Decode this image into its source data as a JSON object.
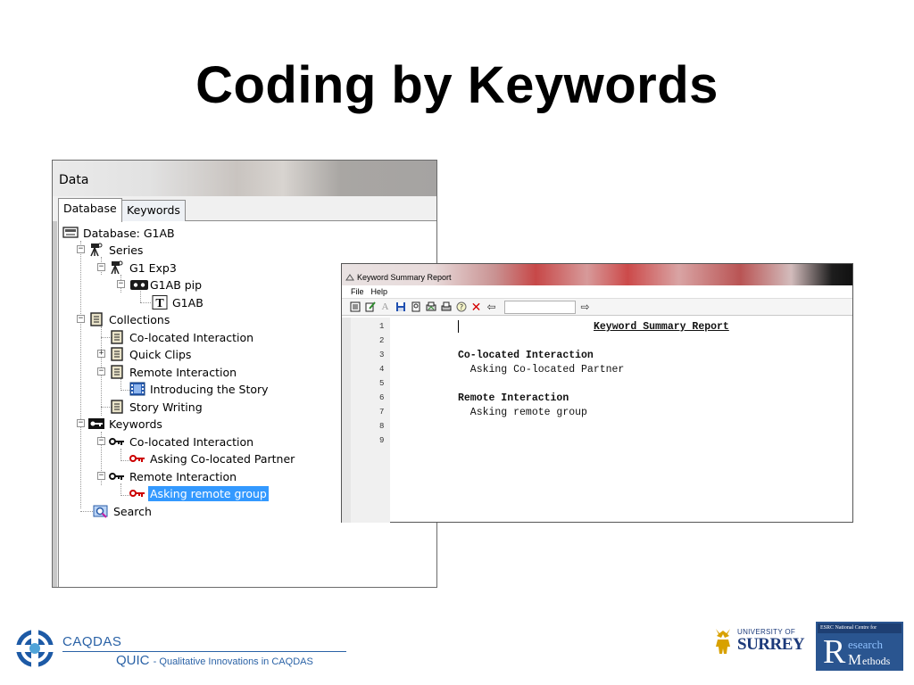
{
  "slide": {
    "title": "Coding by Keywords"
  },
  "data_window": {
    "title": "Data",
    "tabs": [
      {
        "label": "Database",
        "active": true
      },
      {
        "label": "Keywords",
        "active": false
      }
    ],
    "tree": {
      "database": "Database: G1AB",
      "series": "Series",
      "series_g1exp3": "G1 Exp3",
      "g1ab_pip": "G1AB pip",
      "g1ab": "G1AB",
      "collections": "Collections",
      "colocated_interaction": "Co-located Interaction",
      "quick_clips": "Quick Clips",
      "remote_interaction": "Remote Interaction",
      "introducing_story": "Introducing the Story",
      "story_writing": "Story Writing",
      "keywords": "Keywords",
      "kw_colocated_interaction": "Co-located Interaction",
      "kw_asking_colocated_partner": "Asking Co-located Partner",
      "kw_remote_interaction": "Remote Interaction",
      "kw_asking_remote_group": "Asking remote group",
      "search": "Search"
    },
    "selected_item": "Asking remote group"
  },
  "report_window": {
    "title": "Keyword Summary Report",
    "menu": [
      "File",
      "Help"
    ],
    "search_value": "",
    "line_numbers": [
      "1",
      "2",
      "3",
      "4",
      "5",
      "6",
      "7",
      "8",
      "9"
    ],
    "lines": {
      "heading": "Keyword Summary Report",
      "group1": "Co-located Interaction",
      "group1_item": "  Asking Co-located Partner",
      "group2": "Remote Interaction",
      "group2_item": "  Asking remote group"
    }
  },
  "footer": {
    "caqdas": "CAQDAS",
    "quic": "QUIC",
    "quic_tagline": "- Qualitative Innovations in CAQDAS",
    "surrey_small": "UNIVERSITY OF",
    "surrey_big": "SURREY",
    "esrc_top": "ESRC National Centre for",
    "esrc_research": "esearch",
    "esrc_methods": "ethods"
  },
  "colors": {
    "selection": "#3399ff",
    "caqdas_blue": "#2a62a6",
    "surrey_navy": "#1c3a7a",
    "report_red_icon": "#cc0000"
  }
}
